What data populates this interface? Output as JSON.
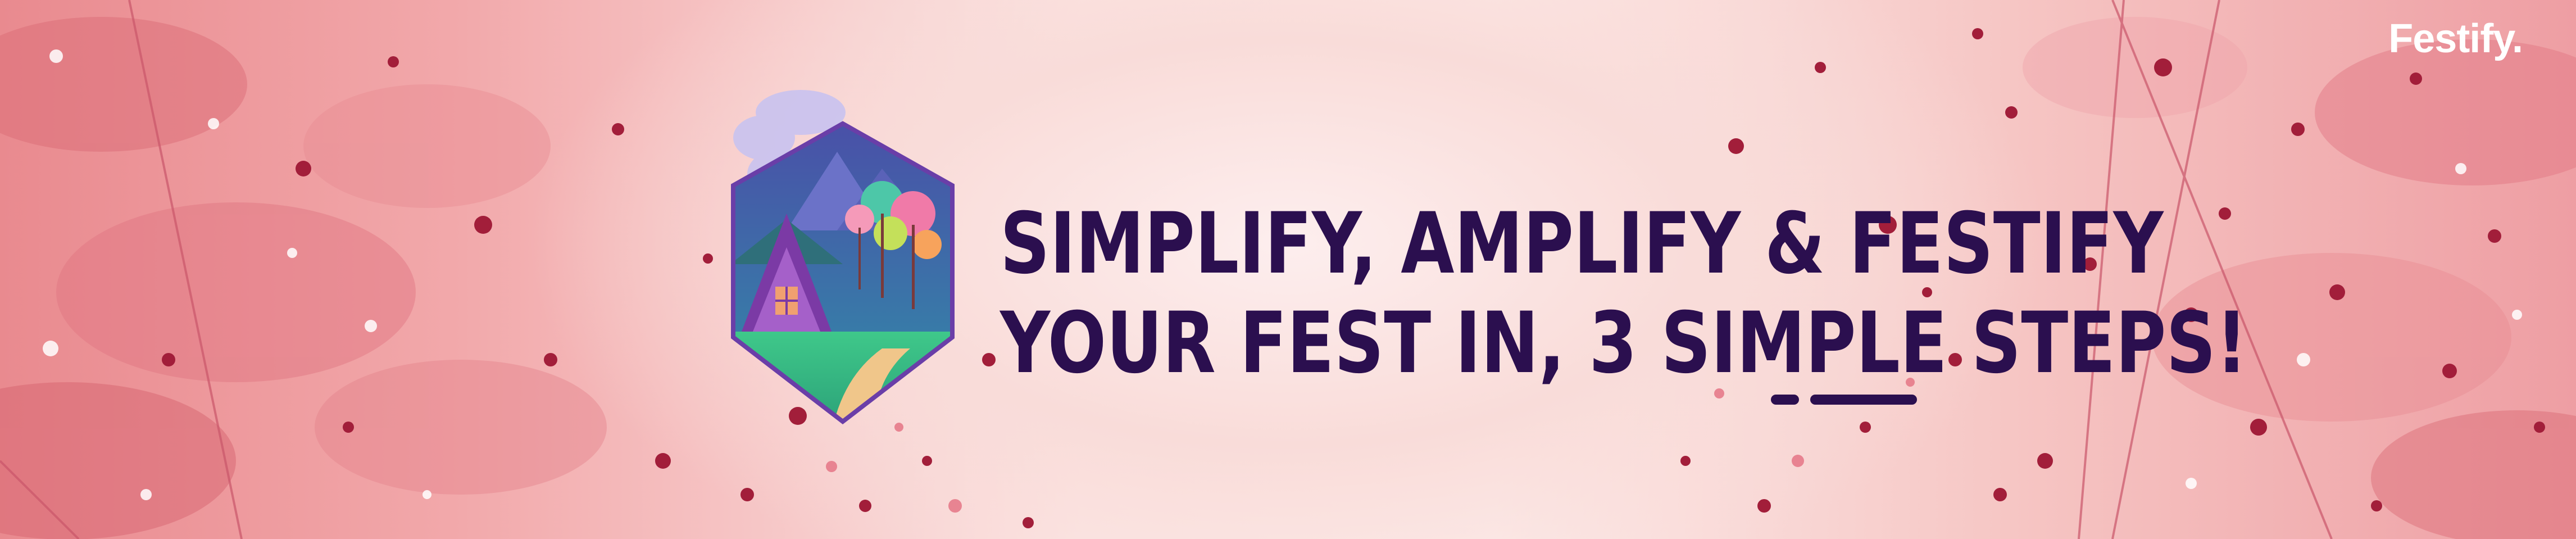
{
  "brand": {
    "name": "Festify."
  },
  "headline": {
    "line1": "Simplify, Amplify & Festify",
    "line2": "Your Fest In, 3 Simple Steps!"
  },
  "colors": {
    "headline": "#2b0f4f",
    "brand": "#ffffff",
    "background_pink": "#ee9ea3",
    "background_light": "#fcecea",
    "speckle_dark": "#a21e3a"
  },
  "icons": {
    "emblem": "house-in-forest-hexagon-icon"
  }
}
